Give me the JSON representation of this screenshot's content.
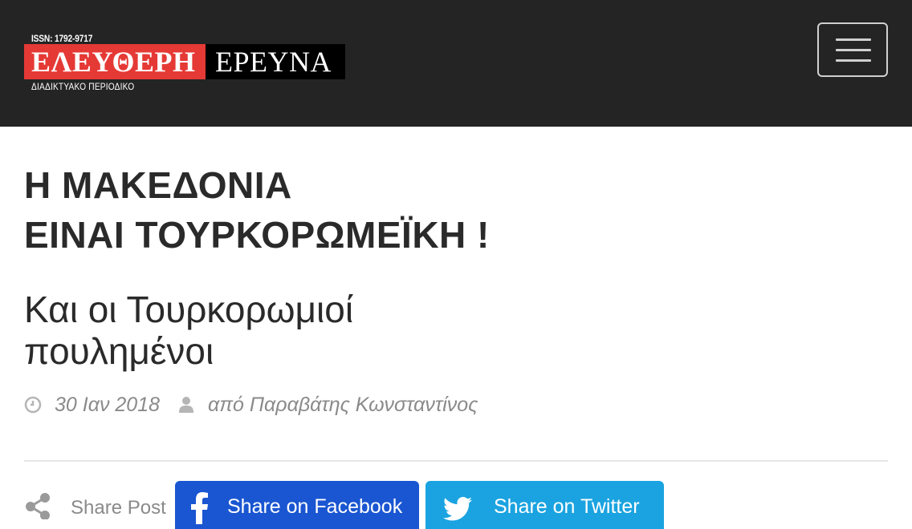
{
  "header": {
    "logo": {
      "issn": "ISSN: 1792-9717",
      "name_part1": "ΕΛΕΥΘΕΡΗ",
      "name_part2": "ΕΡΕΥΝΑ",
      "tagline": "ΔΙΑΔΙΚΤΥΑΚΟ ΠΕΡΙΟΔΙΚΟ"
    },
    "menu_icon": "hamburger-menu-icon"
  },
  "article": {
    "title_line1": "Η ΜΑΚΕΔΟΝΙΑ",
    "title_line2": "ΕΙΝΑΙ ΤΟΥΡΚΟΡΩΜΕΪΚΗ !",
    "subtitle_line1": "Και οι Τουρκορωμιοί",
    "subtitle_line2": "πουλημένοι",
    "date": "30 Ιαν 2018",
    "author": "από Παραβάτης Κωνσταντίνος"
  },
  "share": {
    "label": "Share Post",
    "facebook_label": "Share on Facebook",
    "twitter_label": "Share on Twitter"
  },
  "colors": {
    "header_bg": "#242424",
    "logo_red": "#e53935",
    "facebook_blue": "#1a56d1",
    "twitter_blue": "#1aa3e0"
  }
}
